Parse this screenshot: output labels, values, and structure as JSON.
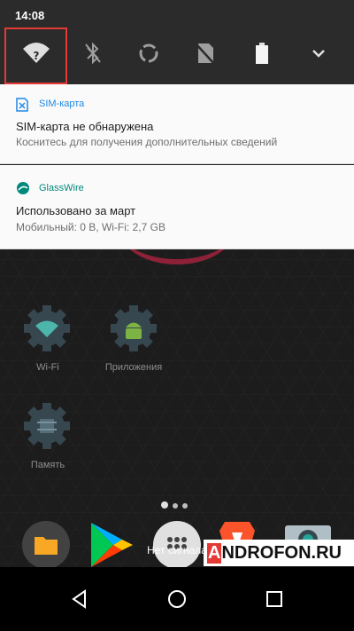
{
  "status_bar": {
    "time": "14:08"
  },
  "quick_settings": {
    "tiles": [
      "wifi-unknown-icon",
      "bluetooth-off-icon",
      "auto-rotate-icon",
      "no-sim-icon",
      "battery-icon",
      "expand-icon"
    ]
  },
  "notifications": [
    {
      "app": "SIM-карта",
      "app_color": "#1e88e5",
      "title": "SIM-карта не обнаружена",
      "text": "Коснитесь для получения дополнительных сведений"
    },
    {
      "app": "GlassWire",
      "app_color": "#00897b",
      "title": "Использовано за март",
      "text": "Мобильный: 0 B, Wi-Fi: 2,7 GB"
    }
  ],
  "home": {
    "shortcuts": [
      {
        "label": "Wi-Fi",
        "icon": "wifi-gear-icon"
      },
      {
        "label": "Приложения",
        "icon": "android-gear-icon"
      },
      {
        "label": "Память",
        "icon": "memory-gear-icon"
      }
    ],
    "dock": [
      "folder-icon",
      "play-store-icon",
      "app-drawer-icon",
      "brave-icon",
      "camera-icon"
    ],
    "status": "Нет сигнала"
  },
  "watermark": {
    "prefix": "A",
    "rest": "NDROFON.RU"
  },
  "colors": {
    "highlight": "#e53935",
    "accent_teal": "#00897b",
    "qs_bg": "#2b2b2b"
  }
}
